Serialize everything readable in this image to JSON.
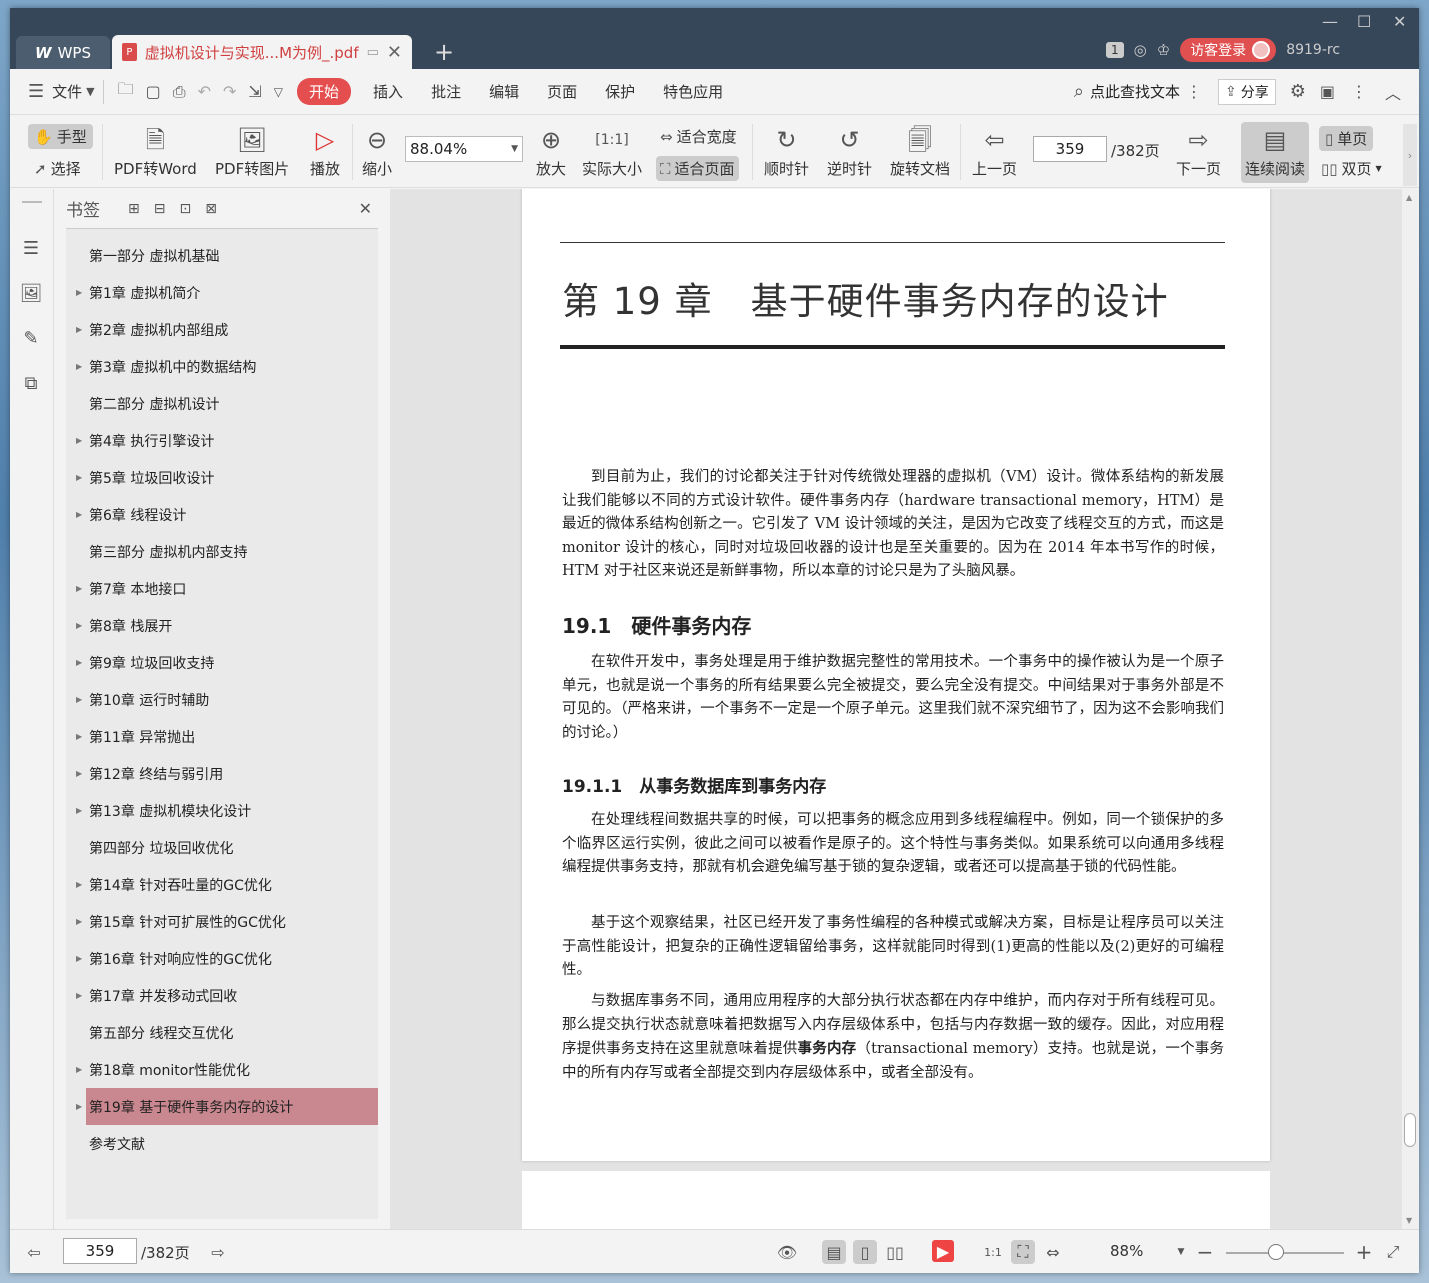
{
  "titlebar": {
    "app_label": "WPS",
    "doc_tab": "虚拟机设计与实现...M为例_.pdf",
    "badge": "1",
    "login": "访客登录",
    "user": "8919-rc"
  },
  "menu": {
    "file": "文件",
    "tabs": [
      "开始",
      "插入",
      "批注",
      "编辑",
      "页面",
      "保护",
      "特色应用"
    ],
    "search": "点此查找文本",
    "share": "分享"
  },
  "ribbon": {
    "hand": "手型",
    "select": "选择",
    "pdf_word": "PDF转Word",
    "pdf_img": "PDF转图片",
    "play": "播放",
    "zoom_out": "缩小",
    "zoom_value": "88.04%",
    "zoom_in": "放大",
    "actual": "实际大小",
    "fit_width": "适合宽度",
    "fit_page": "适合页面",
    "cw": "顺时针",
    "ccw": "逆时针",
    "rotate": "旋转文档",
    "prev": "上一页",
    "page": "359",
    "total": "/382页",
    "next": "下一页",
    "continuous": "连续阅读",
    "single": "单页",
    "double": "双页"
  },
  "bookmarks": {
    "title": "书签",
    "items": [
      {
        "label": "第一部分 虚拟机基础",
        "arrow": false
      },
      {
        "label": "第1章 虚拟机简介",
        "arrow": true
      },
      {
        "label": "第2章 虚拟机内部组成",
        "arrow": true
      },
      {
        "label": "第3章 虚拟机中的数据结构",
        "arrow": true
      },
      {
        "label": "第二部分 虚拟机设计",
        "arrow": false
      },
      {
        "label": "第4章 执行引擎设计",
        "arrow": true
      },
      {
        "label": "第5章 垃圾回收设计",
        "arrow": true
      },
      {
        "label": "第6章 线程设计",
        "arrow": true
      },
      {
        "label": "第三部分 虚拟机内部支持",
        "arrow": false
      },
      {
        "label": "第7章 本地接口",
        "arrow": true
      },
      {
        "label": "第8章 栈展开",
        "arrow": true
      },
      {
        "label": "第9章 垃圾回收支持",
        "arrow": true
      },
      {
        "label": "第10章 运行时辅助",
        "arrow": true
      },
      {
        "label": "第11章 异常抛出",
        "arrow": true
      },
      {
        "label": "第12章 终结与弱引用",
        "arrow": true
      },
      {
        "label": "第13章 虚拟机模块化设计",
        "arrow": true
      },
      {
        "label": "第四部分 垃圾回收优化",
        "arrow": false
      },
      {
        "label": "第14章 针对吞吐量的GC优化",
        "arrow": true
      },
      {
        "label": "第15章 针对可扩展性的GC优化",
        "arrow": true
      },
      {
        "label": "第16章 针对响应性的GC优化",
        "arrow": true
      },
      {
        "label": "第17章 并发移动式回收",
        "arrow": true
      },
      {
        "label": "第五部分 线程交互优化",
        "arrow": false
      },
      {
        "label": "第18章 monitor性能优化",
        "arrow": true
      },
      {
        "label": "第19章 基于硬件事务内存的设计",
        "arrow": true
      },
      {
        "label": "参考文献",
        "arrow": false
      }
    ],
    "selected_index": 23
  },
  "page": {
    "chapter": "第 19 章　基于硬件事务内存的设计",
    "intro": "到目前为止，我们的讨论都关注于针对传统微处理器的虚拟机（VM）设计。微体系结构的新发展让我们能够以不同的方式设计软件。硬件事务内存（hardware transactional memory，HTM）是最近的微体系结构创新之一。它引发了 VM 设计领域的关注，是因为它改变了线程交互的方式，而这是 monitor 设计的核心，同时对垃圾回收器的设计也是至关重要的。因为在 2014 年本书写作的时候，HTM 对于社区来说还是新鲜事物，所以本章的讨论只是为了头脑风暴。",
    "s1_title": "19.1　硬件事务内存",
    "s1_para": "在软件开发中，事务处理是用于维护数据完整性的常用技术。一个事务中的操作被认为是一个原子单元，也就是说一个事务的所有结果要么完全被提交，要么完全没有提交。中间结果对于事务外部是不可见的。（严格来讲，一个事务不一定是一个原子单元。这里我们就不深究细节了，因为这不会影响我们的讨论。）",
    "s2_title": "19.1.1　从事务数据库到事务内存",
    "s2_p1": "在处理线程间数据共享的时候，可以把事务的概念应用到多线程编程中。例如，同一个锁保护的多个临界区运行实例，彼此之间可以被看作是原子的。这个特性与事务类似。如果系统可以向通用多线程编程提供事务支持，那就有机会避免编写基于锁的复杂逻辑，或者还可以提高基于锁的代码性能。",
    "s2_p2": "基于这个观察结果，社区已经开发了事务性编程的各种模式或解决方案，目标是让程序员可以关注于高性能设计，把复杂的正确性逻辑留给事务，这样就能同时得到(1)更高的性能以及(2)更好的可编程性。",
    "s2_p3a": "与数据库事务不同，通用应用程序的大部分执行状态都在内存中维护，而内存对于所有线程可见。那么提交执行状态就意味着把数据写入内存层级体系中，包括与内存数据一致的缓存。因此，对应用程序提供事务支持在这里就意味着提供",
    "s2_p3b": "事务内存",
    "s2_p3c": "（transactional memory）支持。也就是说，一个事务中的所有内存写或者全部提交到内存层级体系中，或者全部没有。"
  },
  "status": {
    "page": "359",
    "total": "/382页",
    "zoom": "88%"
  }
}
